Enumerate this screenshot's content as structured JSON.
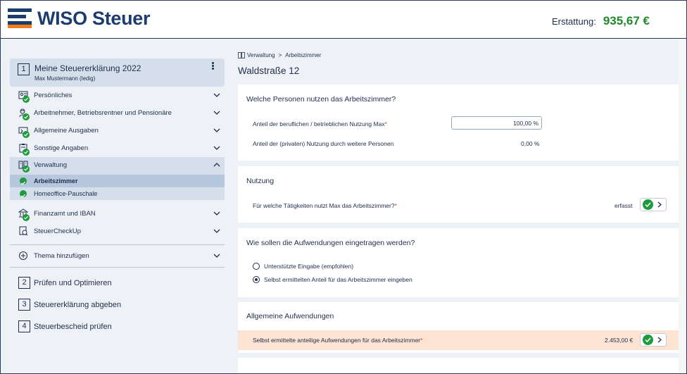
{
  "header": {
    "logo_text": "WISO Steuer",
    "refund_label": "Erstattung:",
    "refund_value": "935,67 €"
  },
  "colors": {
    "brand_navy": "#1d3c6e",
    "brand_orange": "#f07d1a",
    "success_green": "#1f9a3c",
    "refund_green": "#1f8a2a",
    "highlight_row": "#fce3d2"
  },
  "sidebar": {
    "step1": {
      "number": "1",
      "title": "Meine Steuererklärung 2022",
      "subtitle": "Max Mustermann (ledig)"
    },
    "items": [
      {
        "label": "Persönliches",
        "icon": "person-card-icon"
      },
      {
        "label": "Arbeitnehmer, Betriebsrentner und Pensionäre",
        "icon": "worker-icon"
      },
      {
        "label": "Allgemeine Ausgaben",
        "icon": "expenses-icon"
      },
      {
        "label": "Sonstige Angaben",
        "icon": "clipboard-icon"
      },
      {
        "label": "Verwaltung",
        "icon": "building-icon"
      }
    ],
    "sub_items": [
      {
        "label": "Arbeitszimmer"
      },
      {
        "label": "Homeoffice-Pauschale"
      }
    ],
    "items_after": [
      {
        "label": "Finanzamt und IBAN",
        "icon": "tax-office-icon"
      },
      {
        "label": "SteuerCheckUp",
        "icon": "checkup-icon"
      }
    ],
    "add_topic": "Thema hinzufügen",
    "steps": [
      {
        "number": "2",
        "label": "Prüfen und Optimieren"
      },
      {
        "number": "3",
        "label": "Steuererklärung abgeben"
      },
      {
        "number": "4",
        "label": "Steuerbescheid prüfen"
      }
    ]
  },
  "breadcrumb": {
    "parent": "Verwaltung",
    "separator": ">",
    "current": "Arbeitszimmer"
  },
  "page_title": "Waldstraße 12",
  "cards": {
    "persons": {
      "title": "Welche Personen nutzen das Arbeitszimmer?",
      "row1_label": "Anteil der beruflichen / betrieblichen Nutzung  Max",
      "row1_required": "*",
      "row1_value": "100,00 %",
      "row2_label": "Anteil der (privaten) Nutzung durch weitere Personen",
      "row2_value": "0,00 %"
    },
    "usage": {
      "title": "Nutzung",
      "row_label": "Für welche Tätigkeiten nutzt Max das Arbeitszimmer?",
      "row_required": "*",
      "status": "erfasst"
    },
    "entry_mode": {
      "title": "Wie sollen die Aufwendungen eingetragen werden?",
      "option1": "Unterstützte Eingabe (empfohlen)",
      "option2": "Selbst ermittelten Anteil für das Arbeitszimmer eingeben",
      "selected": 2
    },
    "general": {
      "title": "Allgemeine Aufwendungen",
      "row_label": "Selbst ermittelte anteilige Aufwendungen für das Arbeitszimmer",
      "row_required": "*",
      "row_value": "2.453,00 €"
    }
  }
}
